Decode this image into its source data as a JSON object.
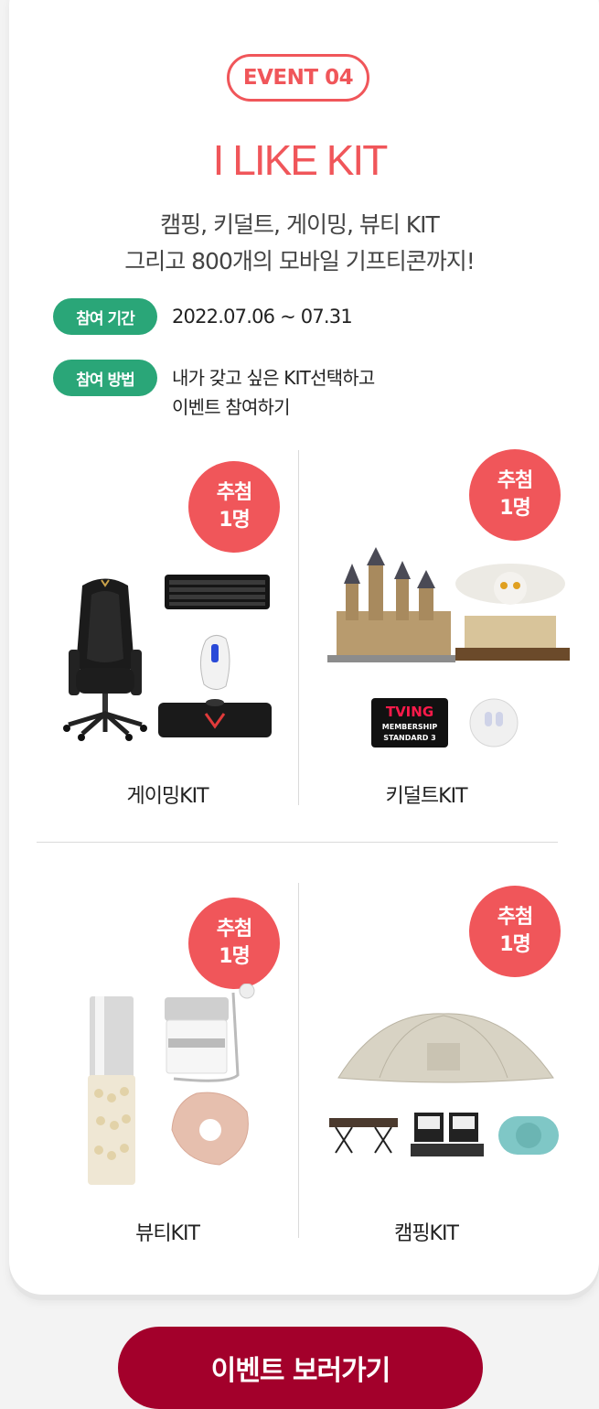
{
  "event": {
    "badge": "EVENT 04",
    "title": "I LIKE KIT",
    "subtitle_line1": "캠핑, 키덜트, 게이밍, 뷰티 KIT",
    "subtitle_line2": "그리고 800개의 모바일 기프티콘까지!"
  },
  "info": {
    "period_label": "참여 기간",
    "period_value": "2022.07.06 ~ 07.31",
    "method_label": "참여 방법",
    "method_line1": "내가 갖고 싶은 KIT선택하고",
    "method_line2": "이벤트 참여하기"
  },
  "kits": [
    {
      "name": "게이밍KIT",
      "draw_line1": "추첨",
      "draw_line2": "1명"
    },
    {
      "name": "키덜트KIT",
      "draw_line1": "추첨",
      "draw_line2": "1명",
      "tving_line1": "TVING",
      "tving_line2": "MEMBERSHIP",
      "tving_line3": "STANDARD 3"
    },
    {
      "name": "뷰티KIT",
      "draw_line1": "추첨",
      "draw_line2": "1명"
    },
    {
      "name": "캠핑KIT",
      "draw_line1": "추첨",
      "draw_line2": "1명"
    }
  ],
  "cta": {
    "label": "이벤트 보러가기"
  },
  "colors": {
    "accent": "#f0565a",
    "green": "#2aa678",
    "cta": "#a3002b"
  }
}
